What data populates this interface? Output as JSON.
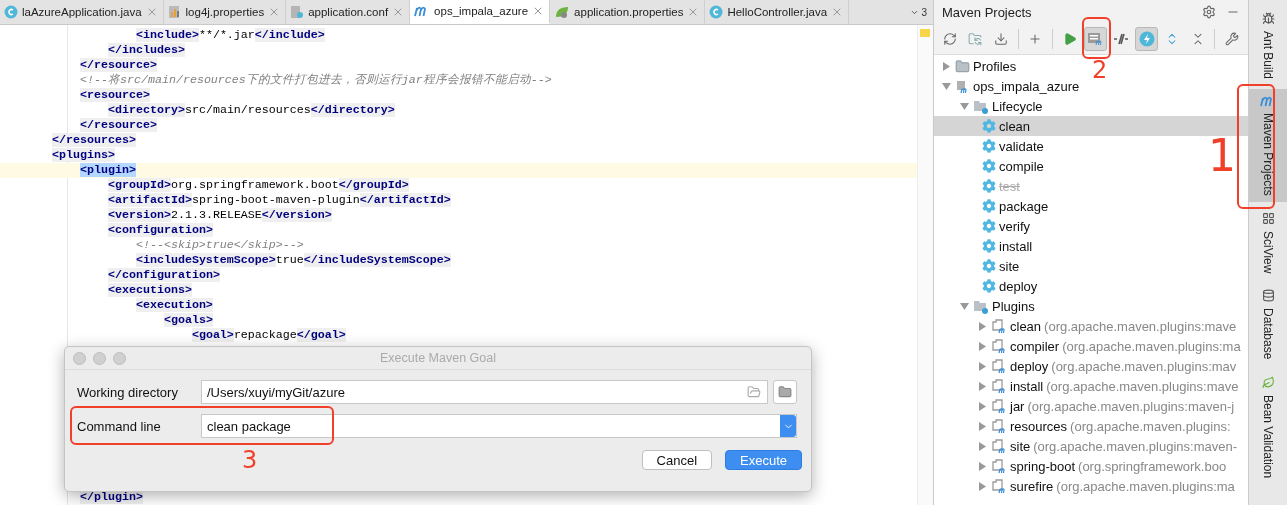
{
  "tabs": [
    {
      "label": "laAzureApplication.java",
      "kind": "class",
      "selected": false
    },
    {
      "label": "log4j.properties",
      "kind": "properties",
      "selected": false
    },
    {
      "label": "application.conf",
      "kind": "conf",
      "selected": false
    },
    {
      "label": "ops_impala_azure",
      "kind": "maven",
      "selected": true
    },
    {
      "label": "application.properties",
      "kind": "spring",
      "selected": false
    },
    {
      "label": "HelloController.java",
      "kind": "class",
      "selected": false
    }
  ],
  "tab_overflow_count": "3",
  "editor": {
    "lines": [
      {
        "current": false,
        "tokens": [
          {
            "kind": "tag",
            "text": "                <include>"
          },
          {
            "kind": "text",
            "text": "**/*.jar"
          },
          {
            "kind": "tag",
            "text": "</include>"
          }
        ]
      },
      {
        "current": false,
        "tokens": [
          {
            "kind": "tag",
            "text": "            </includes>"
          }
        ]
      },
      {
        "current": false,
        "tokens": [
          {
            "kind": "tag",
            "text": "        </resource>"
          }
        ]
      },
      {
        "current": false,
        "tokens": [
          {
            "kind": "comment",
            "text": "        <!--将src/main/resources下的文件打包进去，否则运行jar程序会报错不能启动-->"
          }
        ]
      },
      {
        "current": false,
        "tokens": [
          {
            "kind": "tag",
            "text": "        <resource>"
          }
        ]
      },
      {
        "current": false,
        "tokens": [
          {
            "kind": "tag",
            "text": "            <directory>"
          },
          {
            "kind": "text",
            "text": "src/main/resources"
          },
          {
            "kind": "tag",
            "text": "</directory>"
          }
        ]
      },
      {
        "current": false,
        "tokens": [
          {
            "kind": "tag",
            "text": "        </resource>"
          }
        ]
      },
      {
        "current": false,
        "tokens": [
          {
            "kind": "tag",
            "text": "    </resources>"
          }
        ]
      },
      {
        "current": false,
        "tokens": [
          {
            "kind": "tag",
            "text": "    <plugins>"
          }
        ]
      },
      {
        "current": true,
        "tokens": [
          {
            "kind": "tag",
            "text": "        <plugin>"
          }
        ]
      },
      {
        "current": false,
        "tokens": [
          {
            "kind": "tag",
            "text": "            <groupId>"
          },
          {
            "kind": "text",
            "text": "org.springframework.boot"
          },
          {
            "kind": "tag",
            "text": "</groupId>"
          }
        ]
      },
      {
        "current": false,
        "tokens": [
          {
            "kind": "tag",
            "text": "            <artifactId>"
          },
          {
            "kind": "text",
            "text": "spring-boot-maven-plugin"
          },
          {
            "kind": "tag",
            "text": "</artifactId>"
          }
        ]
      },
      {
        "current": false,
        "tokens": [
          {
            "kind": "tag",
            "text": "            <version>"
          },
          {
            "kind": "text",
            "text": "2.1.3.RELEASE"
          },
          {
            "kind": "tag",
            "text": "</version>"
          }
        ]
      },
      {
        "current": false,
        "tokens": [
          {
            "kind": "tag",
            "text": "            <configuration>"
          }
        ]
      },
      {
        "current": false,
        "tokens": [
          {
            "kind": "comment",
            "text": "                <!--<skip>true</skip>-->"
          }
        ]
      },
      {
        "current": false,
        "tokens": [
          {
            "kind": "tag",
            "text": "                <includeSystemScope>"
          },
          {
            "kind": "text",
            "text": "true"
          },
          {
            "kind": "tag",
            "text": "</includeSystemScope>"
          }
        ]
      },
      {
        "current": false,
        "tokens": [
          {
            "kind": "tag",
            "text": "            </configuration>"
          }
        ]
      },
      {
        "current": false,
        "tokens": [
          {
            "kind": "tag",
            "text": "            <executions>"
          }
        ]
      },
      {
        "current": false,
        "tokens": [
          {
            "kind": "tag",
            "text": "                <execution>"
          }
        ]
      },
      {
        "current": false,
        "tokens": [
          {
            "kind": "tag",
            "text": "                    <goals>"
          }
        ]
      },
      {
        "current": false,
        "tokens": [
          {
            "kind": "tag",
            "text": "                        <goal>"
          },
          {
            "kind": "text",
            "text": "repackage"
          },
          {
            "kind": "tag",
            "text": "</goal>"
          }
        ]
      }
    ],
    "lines_below": [
      {
        "current": false,
        "tokens": [
          {
            "kind": "tag",
            "text": "        </plugin>"
          }
        ]
      }
    ]
  },
  "dialog": {
    "title": "Execute Maven Goal",
    "working_directory": {
      "label": "Working directory",
      "value": "/Users/xuyi/myGit/azure"
    },
    "command_line": {
      "label": "Command line",
      "value": "clean package"
    },
    "buttons": [
      {
        "label": "Cancel",
        "kind": "secondary"
      },
      {
        "label": "Execute",
        "kind": "primary"
      }
    ]
  },
  "maven": {
    "title": "Maven Projects",
    "toolbar": [
      {
        "kind": "refresh",
        "selected": false
      },
      {
        "kind": "folder-sync",
        "selected": false
      },
      {
        "kind": "download",
        "selected": false
      },
      {
        "kind": "sep"
      },
      {
        "kind": "add",
        "selected": false
      },
      {
        "kind": "sep"
      },
      {
        "kind": "run",
        "selected": false
      },
      {
        "kind": "goal",
        "selected": true
      },
      {
        "kind": "skip",
        "selected": false
      },
      {
        "kind": "offline",
        "selected": true
      },
      {
        "kind": "expand",
        "selected": false
      },
      {
        "kind": "collapse",
        "selected": false
      },
      {
        "kind": "sep"
      },
      {
        "kind": "wrench",
        "selected": false
      }
    ],
    "tree": [
      {
        "label": "Profiles",
        "kind": "profiles",
        "expanded": false,
        "selected": false,
        "disabled": false
      },
      {
        "label": "ops_impala_azure",
        "kind": "project",
        "expanded": true,
        "selected": false,
        "disabled": false,
        "children": [
          {
            "label": "Lifecycle",
            "kind": "folder",
            "expanded": true,
            "selected": false,
            "disabled": false,
            "children": [
              {
                "label": "clean",
                "kind": "goal",
                "selected": true,
                "disabled": false
              },
              {
                "label": "validate",
                "kind": "goal",
                "selected": false,
                "disabled": false
              },
              {
                "label": "compile",
                "kind": "goal",
                "selected": false,
                "disabled": false
              },
              {
                "label": "test",
                "kind": "goal",
                "selected": false,
                "disabled": true
              },
              {
                "label": "package",
                "kind": "goal",
                "selected": false,
                "disabled": false
              },
              {
                "label": "verify",
                "kind": "goal",
                "selected": false,
                "disabled": false
              },
              {
                "label": "install",
                "kind": "goal",
                "selected": false,
                "disabled": false
              },
              {
                "label": "site",
                "kind": "goal",
                "selected": false,
                "disabled": false
              },
              {
                "label": "deploy",
                "kind": "goal",
                "selected": false,
                "disabled": false
              }
            ]
          },
          {
            "label": "Plugins",
            "kind": "folder",
            "expanded": true,
            "selected": false,
            "disabled": false,
            "children": [
              {
                "label": "clean",
                "detail": "(org.apache.maven.plugins:mave",
                "kind": "plugin",
                "expanded": false,
                "selected": false,
                "disabled": false
              },
              {
                "label": "compiler",
                "detail": "(org.apache.maven.plugins:ma",
                "kind": "plugin",
                "expanded": false,
                "selected": false,
                "disabled": false
              },
              {
                "label": "deploy",
                "detail": "(org.apache.maven.plugins:mav",
                "kind": "plugin",
                "expanded": false,
                "selected": false,
                "disabled": false
              },
              {
                "label": "install",
                "detail": "(org.apache.maven.plugins:mave",
                "kind": "plugin",
                "expanded": false,
                "selected": false,
                "disabled": false
              },
              {
                "label": "jar",
                "detail": "(org.apache.maven.plugins:maven-j",
                "kind": "plugin",
                "expanded": false,
                "selected": false,
                "disabled": false
              },
              {
                "label": "resources",
                "detail": "(org.apache.maven.plugins:",
                "kind": "plugin",
                "expanded": false,
                "selected": false,
                "disabled": false
              },
              {
                "label": "site",
                "detail": "(org.apache.maven.plugins:maven-",
                "kind": "plugin",
                "expanded": false,
                "selected": false,
                "disabled": false
              },
              {
                "label": "spring-boot",
                "detail": "(org.springframework.boo",
                "kind": "plugin",
                "expanded": false,
                "selected": false,
                "disabled": false
              },
              {
                "label": "surefire",
                "detail": "(org.apache.maven.plugins:ma",
                "kind": "plugin",
                "expanded": false,
                "selected": false,
                "disabled": false
              }
            ]
          }
        ]
      }
    ]
  },
  "side_tabs": [
    {
      "label": "Ant Build",
      "kind": "ant",
      "selected": false
    },
    {
      "label": "Maven Projects",
      "kind": "maven",
      "selected": true
    },
    {
      "label": "SciView",
      "kind": "grid",
      "selected": false
    },
    {
      "label": "Database",
      "kind": "database",
      "selected": false
    },
    {
      "label": "Bean Validation",
      "kind": "bean",
      "selected": false
    }
  ],
  "annotations": [
    {
      "text": "1"
    },
    {
      "text": "2"
    },
    {
      "text": "3"
    }
  ]
}
